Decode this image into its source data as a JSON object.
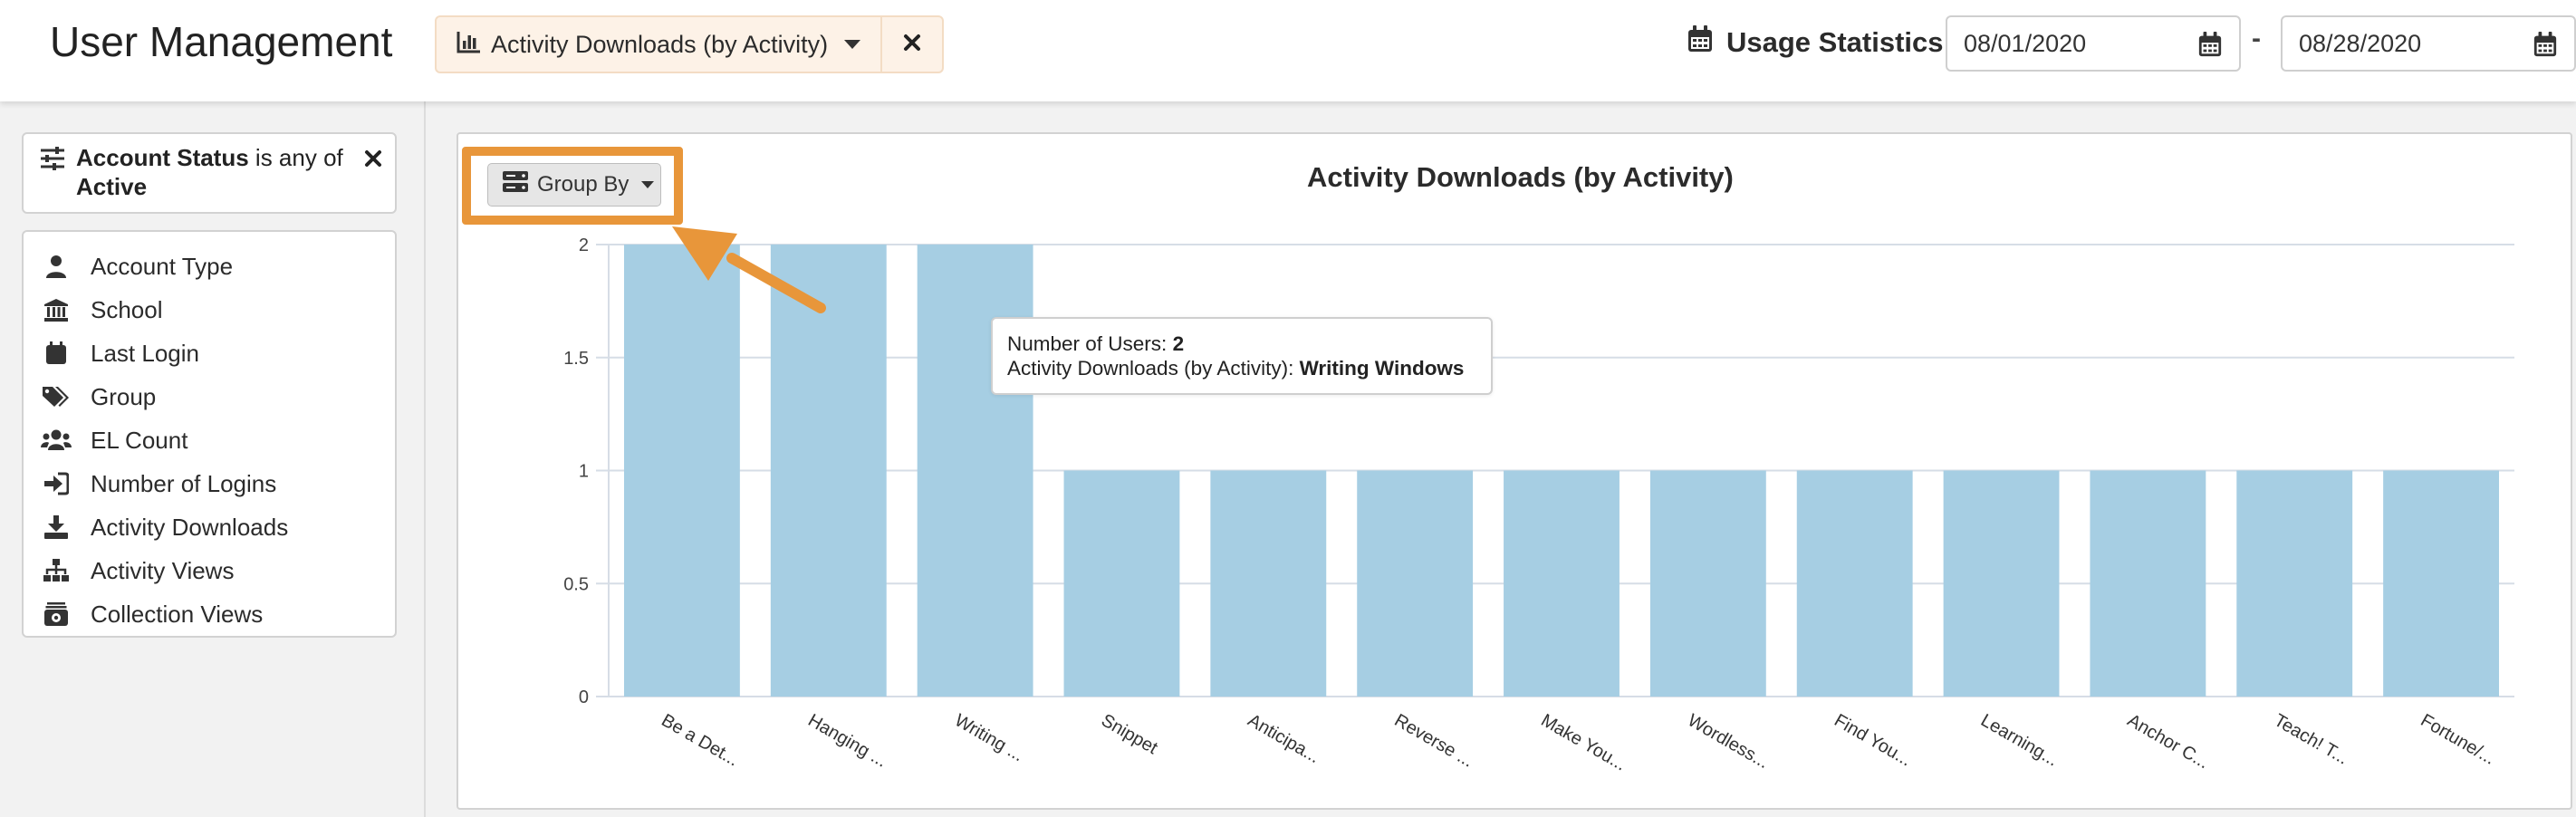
{
  "header": {
    "title": "User Management",
    "report_selector": {
      "label": "Activity Downloads (by Activity)",
      "icon": "bar-chart-icon",
      "close_icon": "close-icon"
    },
    "usage_statistics": {
      "label": "Usage Statistics",
      "icon": "calendar-icon"
    },
    "date_from": "08/01/2020",
    "date_separator": "-",
    "date_to": "08/28/2020"
  },
  "sidebar": {
    "active_filter": {
      "field": "Account Status",
      "operator": "is any of",
      "value": "Active"
    },
    "fields": [
      {
        "label": "Account Type",
        "icon": "user-icon"
      },
      {
        "label": "School",
        "icon": "school-icon"
      },
      {
        "label": "Last Login",
        "icon": "calendar-icon"
      },
      {
        "label": "Group",
        "icon": "tags-icon"
      },
      {
        "label": "EL Count",
        "icon": "users-icon"
      },
      {
        "label": "Number of Logins",
        "icon": "sign-in-icon"
      },
      {
        "label": "Activity Downloads",
        "icon": "download-icon"
      },
      {
        "label": "Activity Views",
        "icon": "sitemap-icon"
      },
      {
        "label": "Collection Views",
        "icon": "collection-icon"
      }
    ]
  },
  "main": {
    "group_by_label": "Group By",
    "tooltip": {
      "line1_label": "Number of Users: ",
      "line1_value": "2",
      "line2_label": "Activity Downloads (by Activity): ",
      "line2_value": "Writing Windows"
    }
  },
  "colors": {
    "bar": "#a6cee3",
    "highlight": "#e8963a",
    "grid": "#d6dde6"
  },
  "chart_data": {
    "type": "bar",
    "title": "Activity Downloads (by Activity)",
    "categories": [
      "Be a Det...",
      "Hanging ...",
      "Writing ...",
      "Snippet",
      "Anticipa...",
      "Reverse ...",
      "Make You...",
      "Wordless...",
      "Find You...",
      "Learning...",
      "Anchor C...",
      "Teach! T...",
      "Fortune/..."
    ],
    "values": [
      2,
      2,
      2,
      1,
      1,
      1,
      1,
      1,
      1,
      1,
      1,
      1,
      1
    ],
    "yticks": [
      "0",
      "0.5",
      "1",
      "1.5",
      "2"
    ],
    "ylim": [
      0,
      2
    ],
    "grid": true,
    "legend": "none"
  }
}
